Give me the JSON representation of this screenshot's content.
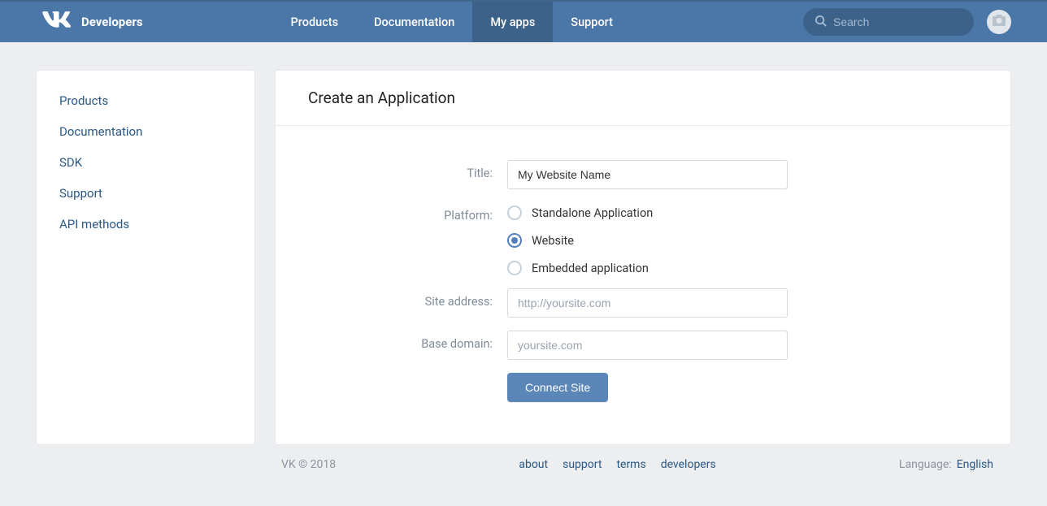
{
  "header": {
    "brand": "Developers",
    "nav": [
      {
        "label": "Products",
        "active": false
      },
      {
        "label": "Documentation",
        "active": false
      },
      {
        "label": "My apps",
        "active": true
      },
      {
        "label": "Support",
        "active": false
      }
    ],
    "search_placeholder": "Search"
  },
  "sidebar": {
    "items": [
      {
        "label": "Products"
      },
      {
        "label": "Documentation"
      },
      {
        "label": "SDK"
      },
      {
        "label": "Support"
      },
      {
        "label": "API methods"
      }
    ]
  },
  "main": {
    "title": "Create an Application",
    "form": {
      "title_label": "Title:",
      "title_value": "My Website Name",
      "platform_label": "Platform:",
      "platform_options": [
        {
          "label": "Standalone Application",
          "selected": false
        },
        {
          "label": "Website",
          "selected": true
        },
        {
          "label": "Embedded application",
          "selected": false
        }
      ],
      "site_address_label": "Site address:",
      "site_address_placeholder": "http://yoursite.com",
      "site_address_value": "",
      "base_domain_label": "Base domain:",
      "base_domain_placeholder": "yoursite.com",
      "base_domain_value": "",
      "submit_label": "Connect Site"
    }
  },
  "footer": {
    "copyright": "VK © 2018",
    "links": [
      {
        "label": "about"
      },
      {
        "label": "support"
      },
      {
        "label": "terms"
      },
      {
        "label": "developers"
      }
    ],
    "language_label": "Language:",
    "language_value": "English"
  }
}
